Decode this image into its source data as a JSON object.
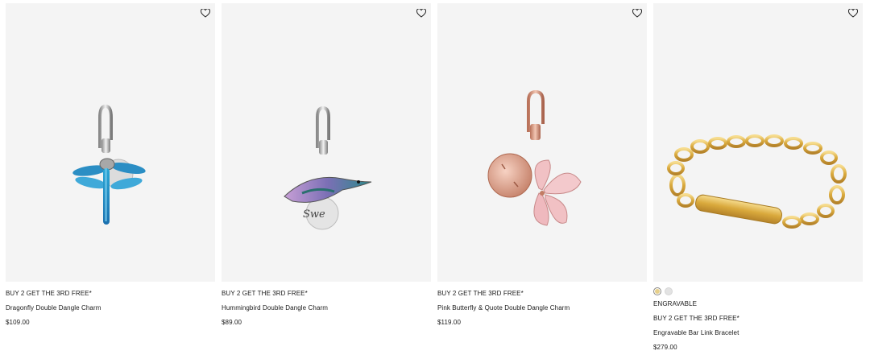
{
  "products": [
    {
      "promo": "BUY 2 GET THE 3RD FREE*",
      "name": "Dragonfly Double Dangle Charm",
      "price": "$109.00",
      "wishlist_icon": "heart-outline-icon"
    },
    {
      "promo": "BUY 2 GET THE 3RD FREE*",
      "name": "Hummingbird Double Dangle Charm",
      "price": "$89.00",
      "wishlist_icon": "heart-outline-icon"
    },
    {
      "promo": "BUY 2 GET THE 3RD FREE*",
      "name": "Pink Butterfly & Quote Double Dangle Charm",
      "price": "$119.00",
      "wishlist_icon": "heart-outline-icon"
    },
    {
      "swatches": [
        {
          "color": "#e6cf8a",
          "selected": true
        },
        {
          "color": "#e3e3e3",
          "selected": false
        }
      ],
      "badge": "ENGRAVABLE",
      "promo": "BUY 2 GET THE 3RD FREE*",
      "name": "Engravable Bar Link Bracelet",
      "price": "$279.00",
      "wishlist_icon": "heart-outline-icon"
    }
  ]
}
